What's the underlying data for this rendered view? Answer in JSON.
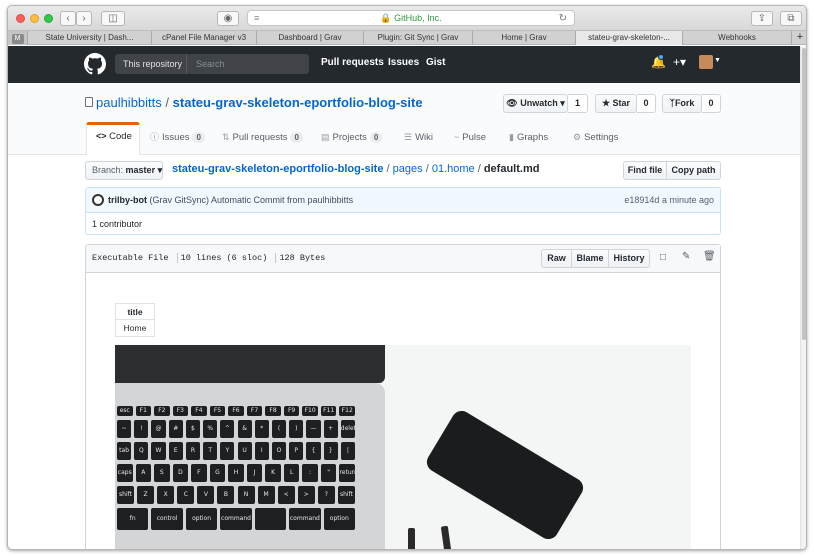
{
  "browser": {
    "url": "GitHub, Inc.",
    "tabs": [
      "State University | Dash...",
      "cPanel File Manager v3",
      "Dashboard | Grav",
      "Plugin: Git Sync | Grav",
      "Home | Grav",
      "stateu-grav-skeleton-...",
      "Webhooks"
    ],
    "pinned_tab": "M",
    "new_tab": "+"
  },
  "header": {
    "scope_label": "This repository",
    "search_placeholder": "Search",
    "nav": [
      "Pull requests",
      "Issues",
      "Gist"
    ],
    "add_label": "+▾"
  },
  "repo": {
    "owner": "paulhibbitts",
    "separator": "/",
    "name": "stateu-grav-skeleton-eportfolio-blog-site",
    "unwatch_label": "Unwatch ▾",
    "watch_count": "1",
    "star_label": "Star",
    "star_count": "0",
    "fork_label": "Fork",
    "fork_count": "0"
  },
  "repo_tabs": [
    {
      "label": "Code",
      "icon": "<>"
    },
    {
      "label": "Issues",
      "icon": "ⓘ",
      "count": "0"
    },
    {
      "label": "Pull requests",
      "icon": "⇅",
      "count": "0"
    },
    {
      "label": "Projects",
      "icon": "▤",
      "count": "0"
    },
    {
      "label": "Wiki",
      "icon": "☰"
    },
    {
      "label": "Pulse",
      "icon": "~"
    },
    {
      "label": "Graphs",
      "icon": "▮"
    },
    {
      "label": "Settings",
      "icon": "⚙"
    }
  ],
  "file_nav": {
    "branch_label": "Branch:",
    "branch": "master ▾",
    "path_repo": "stateu-grav-skeleton-eportfolio-blog-site",
    "path_sep": "/",
    "path_1": "pages",
    "path_2": "01.home",
    "file": "default.md",
    "find_file": "Find file",
    "copy_path": "Copy path"
  },
  "commit": {
    "author": "trilby-bot",
    "message": "(Grav GitSync) Automatic Commit from paulhibbitts",
    "sha": "e18914d",
    "time": "a minute ago",
    "contributors": "1 contributor"
  },
  "file_header": {
    "mode": "Executable File",
    "lines": "10 lines (6 sloc)",
    "size": "128 Bytes",
    "raw": "Raw",
    "blame": "Blame",
    "history": "History"
  },
  "frontmatter": {
    "header": "title",
    "value": "Home"
  },
  "keyboard": {
    "row1": [
      "esc",
      "F1",
      "F2",
      "F3",
      "F4",
      "F5",
      "F6",
      "F7",
      "F8",
      "F9",
      "F10",
      "F11",
      "F12"
    ],
    "row2": [
      "~",
      "!",
      "@",
      "#",
      "$",
      "%",
      "^",
      "&",
      "*",
      "(",
      ")",
      "—",
      "+",
      "delete"
    ],
    "row3": [
      "tab",
      "Q",
      "W",
      "E",
      "R",
      "T",
      "Y",
      "U",
      "I",
      "O",
      "P",
      "{",
      "}",
      "|"
    ],
    "row4": [
      "caps",
      "A",
      "S",
      "D",
      "F",
      "G",
      "H",
      "J",
      "K",
      "L",
      ":",
      "\"",
      "return"
    ],
    "row5": [
      "shift",
      "Z",
      "X",
      "C",
      "V",
      "B",
      "N",
      "M",
      "<",
      ">",
      "?",
      "shift"
    ],
    "row6": [
      "fn",
      "control",
      "option",
      "command",
      "",
      "command",
      "option"
    ]
  },
  "colors": {
    "header_bg": "#24292e",
    "link": "#0366d6",
    "tab_accent": "#e36209",
    "commit_bg": "#f1f8ff"
  }
}
